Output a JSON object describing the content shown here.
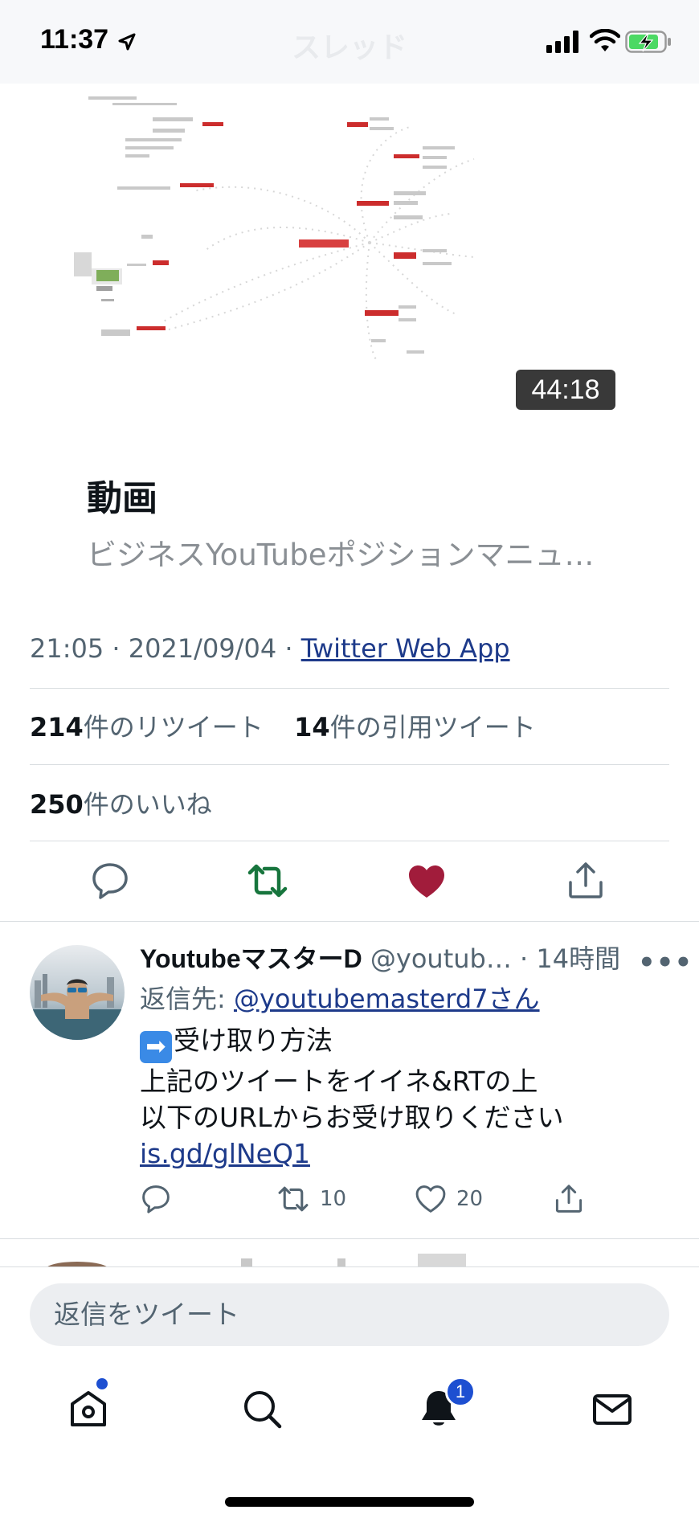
{
  "status_bar": {
    "time": "11:37",
    "faded_title": "スレッド"
  },
  "media_card": {
    "duration": "44:18",
    "type_label": "動画",
    "title": "ビジネスYouTubeポジションマニュ…"
  },
  "tweet_meta": {
    "time": "21:05",
    "separator": " · ",
    "date": "2021/09/04",
    "source": "Twitter Web App"
  },
  "stats": {
    "retweets_count": "214",
    "retweets_label": "件のリツイート",
    "quotes_count": "14",
    "quotes_label": "件の引用ツイート",
    "likes_count": "250",
    "likes_label": "件のいいね"
  },
  "actions": {
    "liked": true,
    "retweeted": true,
    "retweet_color": "#17753d",
    "like_color": "#a11c3b"
  },
  "reply": {
    "name": "YoutubeマスターD",
    "handle": "@youtub…",
    "time": "· 14時間",
    "more": "•••",
    "reply_to_prefix": "返信先: ",
    "reply_to_user": "@youtubemasterd7さん",
    "body_line1": "受け取り方法",
    "body_line2": "上記のツイートをイイネ&RTの上",
    "body_line3": "以下のURLからお受け取りください",
    "link": "is.gd/glNeQ1",
    "retweet_count": "10",
    "like_count": "20"
  },
  "composer": {
    "placeholder": "返信をツイート"
  },
  "tab_bar": {
    "notification_badge": "1"
  }
}
